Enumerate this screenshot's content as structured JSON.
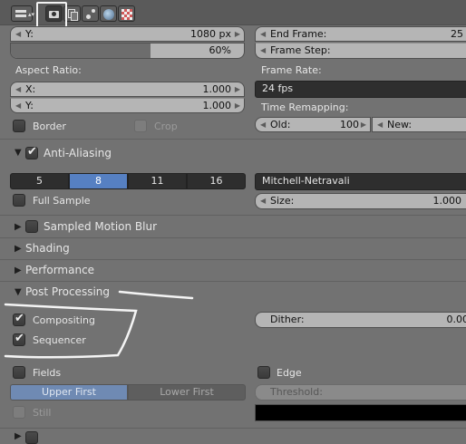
{
  "header": {
    "icons": [
      "editor-type-icon",
      "render-camera-icon",
      "render-layers-icon",
      "scene-icon",
      "world-icon",
      "texture-icon"
    ]
  },
  "dimensions": {
    "res_y_label": "Y:",
    "res_y_value": "1080 px",
    "res_percent": "60%",
    "res_percent_fraction": 0.6,
    "aspect_ratio_label": "Aspect Ratio:",
    "aspect_x_label": "X:",
    "aspect_x_value": "1.000",
    "aspect_y_label": "Y:",
    "aspect_y_value": "1.000",
    "border_label": "Border",
    "crop_label": "Crop",
    "end_frame_label": "End Frame:",
    "end_frame_value": "25",
    "frame_step_label": "Frame Step:",
    "frame_rate_label": "Frame Rate:",
    "frame_rate_value": "24 fps",
    "time_remapping_label": "Time Remapping:",
    "old_label": "Old:",
    "old_value": "100",
    "new_label": "New:"
  },
  "anti_aliasing": {
    "title": "Anti-Aliasing",
    "enabled": true,
    "samples": [
      "5",
      "8",
      "11",
      "16"
    ],
    "selected": "8",
    "filter": "Mitchell-Netravali",
    "full_sample_label": "Full Sample",
    "size_label": "Size:",
    "size_value": "1.000"
  },
  "panels": {
    "motion_blur": "Sampled Motion Blur",
    "shading": "Shading",
    "performance": "Performance",
    "post_processing": "Post Processing"
  },
  "post_processing": {
    "compositing_label": "Compositing",
    "compositing_checked": true,
    "sequencer_label": "Sequencer",
    "sequencer_checked": true,
    "dither_label": "Dither:",
    "dither_value": "0.00",
    "fields_label": "Fields",
    "edge_label": "Edge",
    "upper_first": "Upper First",
    "lower_first": "Lower First",
    "threshold_label": "Threshold:",
    "still_label": "Still",
    "edge_color": "#000000"
  },
  "colors": {
    "panel_bg": "#727272",
    "field_bg": "#b5b5b5",
    "dark_widget": "#2e2e2e",
    "selected_blue": "#5680c2",
    "annotation": "#ffffff"
  }
}
